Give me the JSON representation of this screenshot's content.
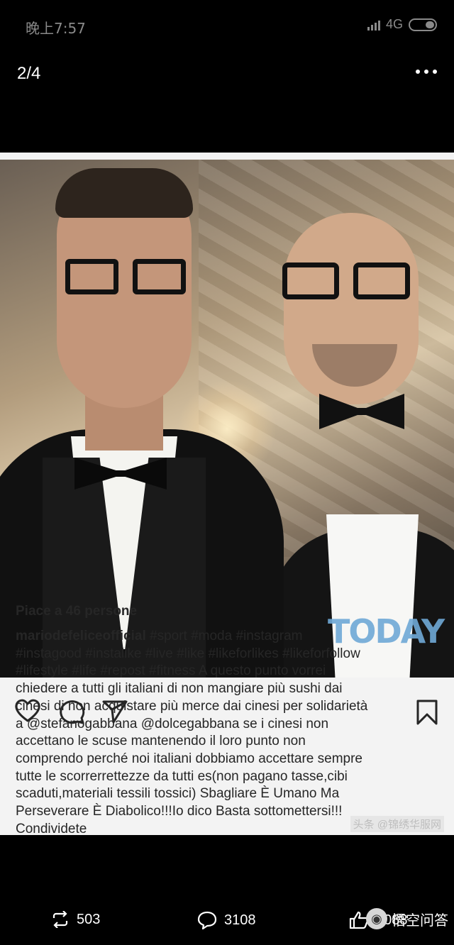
{
  "status_bar": {
    "time": "晚上7:57",
    "network": "4G",
    "icons": [
      "signal-icon",
      "battery-icon"
    ]
  },
  "viewer": {
    "page_counter": "2/4",
    "more_icon": "more-icon"
  },
  "post": {
    "photo_watermark": "TODAY",
    "action_icons": [
      "heart-icon",
      "comment-icon",
      "share-icon",
      "bookmark-icon"
    ],
    "likes": "Piace a 46 persone",
    "caption_user": "mariodefeliceofficial",
    "caption_lines": [
      " #sport #moda #instagram",
      "#instagood #instalike #live #like #likeforlikes #likeforfollow",
      "#lifestyle #life #repost #fitness A questo punto vorrei",
      "chiedere a tutti gli italiani di non mangiare più sushi dai",
      "cinesi di non acquistare più merce dai cinesi per solidarietà",
      "a @stefanogabbana @dolcegabbana se i cinesi non",
      "accettano le scuse mantenendo il loro punto non",
      "comprendo perché noi italiani dobbiamo accettare sempre",
      "tutte le scorrerrettezze da tutti es(non pagano tasse,cibi",
      "scaduti,materiali tessili tossici) Sbagliare È Umano Ma",
      "Perseverare È Diabolico!!!Io dico Basta sottomettersi!!!",
      "Condividete"
    ],
    "source_watermark": "头条 @锦绣华服网"
  },
  "bottom_bar": {
    "repost_count": "503",
    "comment_count": "3108",
    "like_count": "2088",
    "brand": "悟空问答",
    "icons": [
      "repost-icon",
      "comment-bubble-icon",
      "thumbs-up-icon",
      "wukong-logo-icon"
    ]
  }
}
